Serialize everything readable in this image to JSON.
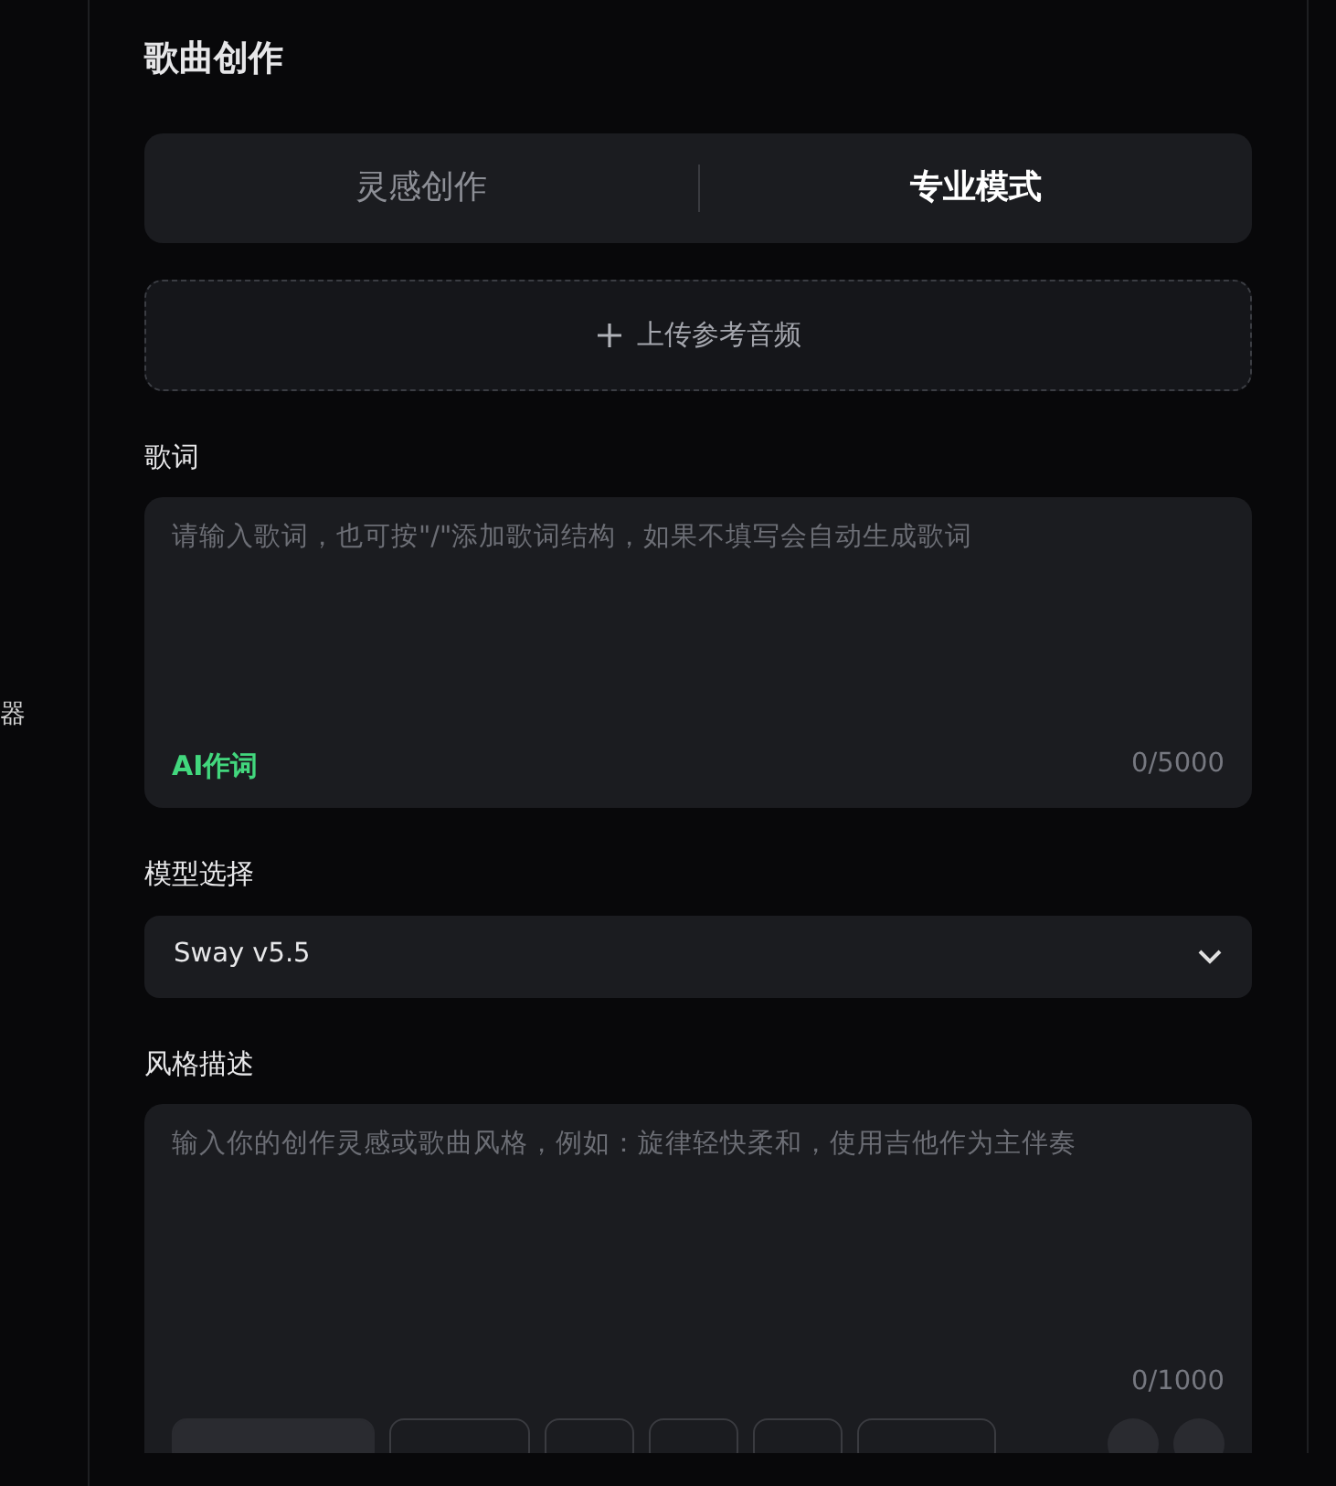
{
  "sidebar": {
    "text": "器"
  },
  "title": "歌曲创作",
  "tabs": [
    {
      "label": "灵感创作",
      "selected": false
    },
    {
      "label": "专业模式",
      "selected": true
    }
  ],
  "upload": {
    "label": "上传参考音频"
  },
  "lyrics": {
    "label": "歌词",
    "placeholder": "请输入歌词，也可按\"/\"添加歌词结构，如果不填写会自动生成歌词",
    "ai_button": "AI作词",
    "counter": "0/5000"
  },
  "model": {
    "label": "模型选择",
    "value": "Sway v5.5"
  },
  "style": {
    "label": "风格描述",
    "placeholder": "输入你的创作灵感或歌曲风格，例如：旋律轻快柔和，使用吉他作为主伴奏",
    "counter": "0/1000"
  }
}
